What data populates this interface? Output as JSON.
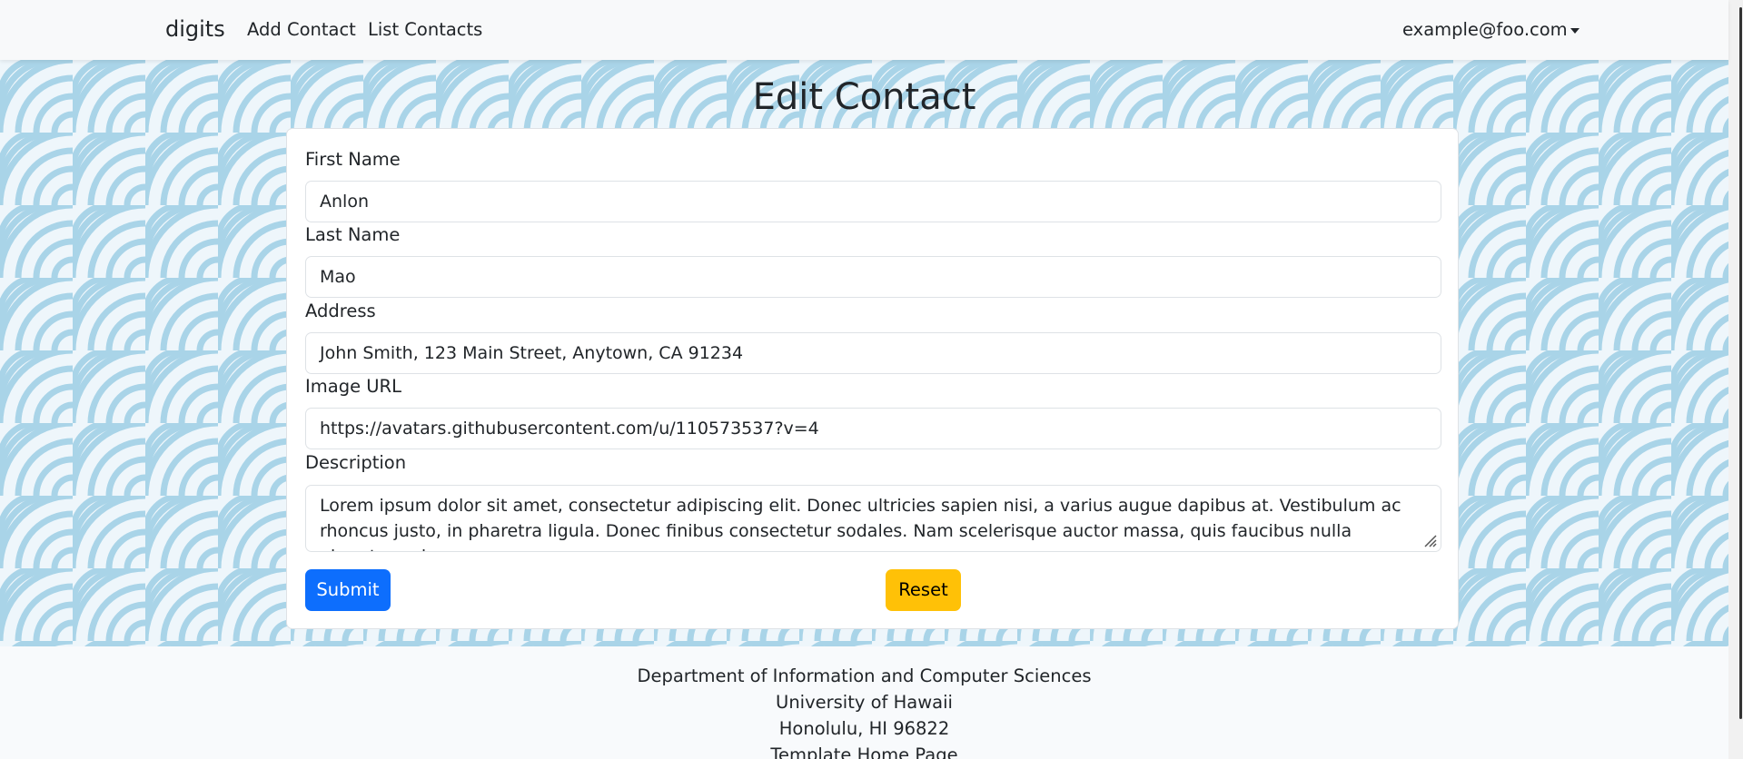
{
  "navbar": {
    "brand": "digits",
    "links": [
      "Add Contact",
      "List Contacts"
    ],
    "user": "example@foo.com"
  },
  "page": {
    "title": "Edit Contact"
  },
  "form": {
    "first_name_label": "First Name",
    "first_name_value": "Anlon",
    "last_name_label": "Last Name",
    "last_name_value": "Mao",
    "address_label": "Address",
    "address_value": "John Smith, 123 Main Street, Anytown, CA 91234",
    "image_url_label": "Image URL",
    "image_url_value": "https://avatars.githubusercontent.com/u/110573537?v=4",
    "description_label": "Description",
    "description_value": "Lorem ipsum dolor sit amet, consectetur adipiscing elit. Donec ultricies sapien nisi, a varius augue dapibus at. Vestibulum ac rhoncus justo, in pharetra ligula. Donec finibus consectetur sodales. Nam scelerisque auctor massa, quis faucibus nulla pharetra quis.",
    "submit_label": "Submit",
    "reset_label": "Reset"
  },
  "footer": {
    "lines": [
      "Department of Information and Computer Sciences",
      "University of Hawaii",
      "Honolulu, HI 96822",
      "Template Home Page"
    ]
  },
  "colors": {
    "primary": "#0d6efd",
    "warning": "#ffc107",
    "pattern": "#a9d4e8"
  }
}
